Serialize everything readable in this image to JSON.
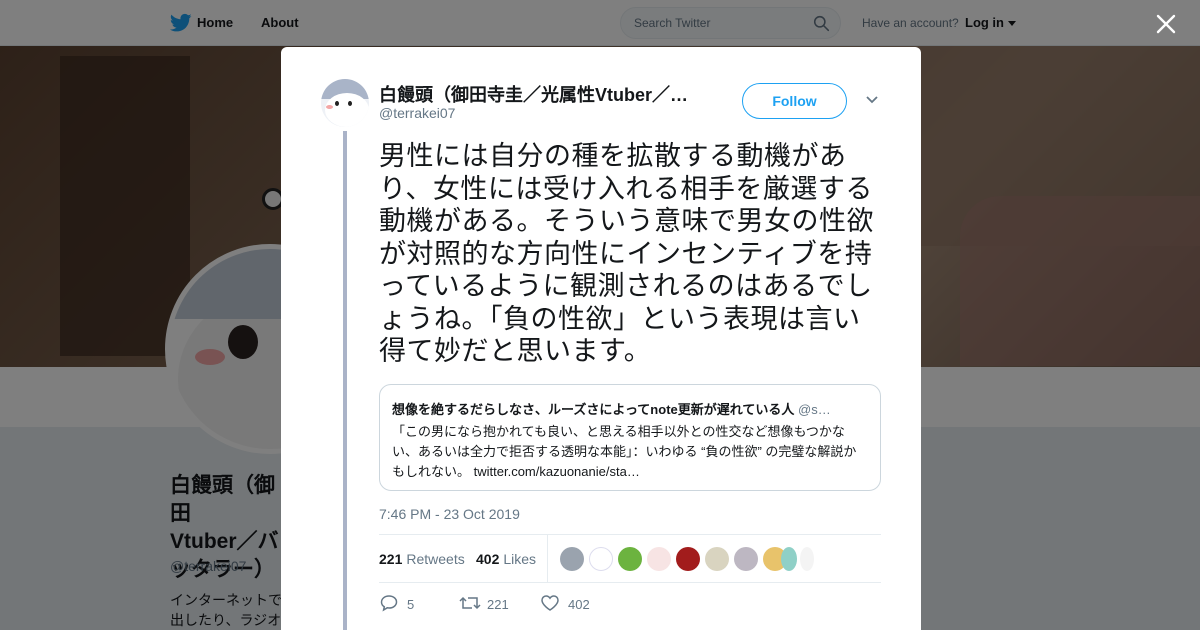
{
  "nav": {
    "home_label": "Home",
    "about_label": "About",
    "search_placeholder": "Search Twitter",
    "have_account": "Have an account?",
    "login_label": "Log in"
  },
  "profile": {
    "name": "白饅頭（御田寺圭／光属性Vtuber／バッタラー）",
    "name_lines": "白饅頭（御田\nVtuber／バ\nッタラー）",
    "handle": "@terrakei07",
    "bio": "インターネットで\n出したり、ラジオ"
  },
  "tweet": {
    "display_name": "白饅頭（御田寺圭／光属性Vtuber／…",
    "handle": "@terrakei07",
    "follow_label": "Follow",
    "text": "男性には自分の種を拡散する動機があり、女性には受け入れる相手を厳選する動機がある。そういう意味で男女の性欲が対照的な方向性にインセンティブを持っているように観測されるのはあるでしょうね。「負の性欲」という表現は言い得て妙だと思います。",
    "quote": {
      "name": "想像を絶するだらしなさ、ルーズさによってnote更新が遅れている人",
      "handle": "@s…",
      "text": "「この男になら抱かれても良い、と思える相手以外との性交など想像もつかない、あるいは全力で拒否する透明な本能」：いわゆる “負の性欲” の完璧な解説かもしれない。 ",
      "link": "twitter.com/kazuonanie/sta…"
    },
    "timestamp": "7:46 PM - 23 Oct 2019",
    "retweets_count": "221",
    "retweets_label": "Retweets",
    "likes_count": "402",
    "likes_label": "Likes",
    "actions": {
      "reply_count": "5",
      "retweet_count": "221",
      "like_count": "402"
    }
  },
  "colors": {
    "accent": "#1da1f2",
    "text": "#14171a",
    "secondary": "#657786",
    "likers": [
      "#9aa3ae",
      "#ffffff",
      "#6cb33f",
      "#f7e4e4",
      "#a21c1c",
      "#d9d4c0",
      "#bdb7c2",
      "#e8c36b",
      "#8fd0c7",
      "#f4f4f4"
    ]
  },
  "icons": [
    "twitter-bird-icon",
    "search-icon",
    "close-icon",
    "chevron-down-icon",
    "reply-icon",
    "retweet-icon",
    "heart-icon"
  ]
}
